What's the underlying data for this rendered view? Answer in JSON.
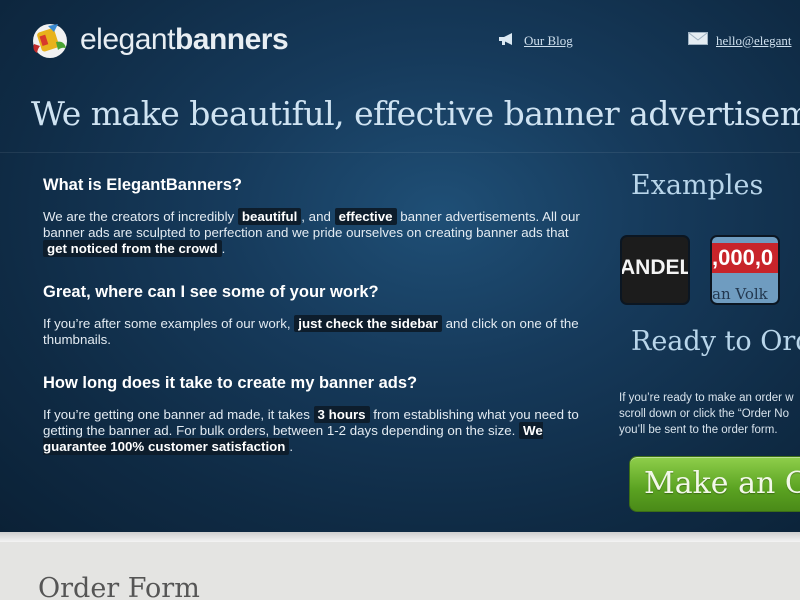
{
  "brand": {
    "name_light": "elegant",
    "name_bold": "banners"
  },
  "nav": {
    "blog_label": "Our Blog",
    "email_label": "hello@elegant"
  },
  "headline": "We make beautiful, effective banner advertisements f",
  "sections": [
    {
      "title": "What is ElegantBanners?",
      "body": [
        {
          "t": "We are the creators of incredibly "
        },
        {
          "t": "beautiful",
          "hl": true
        },
        {
          "t": ", and "
        },
        {
          "t": "effective",
          "hl": true
        },
        {
          "t": " banner advertisements. All our banner ads are sculpted to perfection and we pride ourselves on creating banner ads that "
        },
        {
          "t": "get noticed from the crowd",
          "hl": true
        },
        {
          "t": "."
        }
      ]
    },
    {
      "title": "Great, where can I see some of your work?",
      "body": [
        {
          "t": "If you’re after some examples of our work, "
        },
        {
          "t": "just check the sidebar",
          "hl": true
        },
        {
          "t": " and click on one of the thumbnails."
        }
      ]
    },
    {
      "title": "How long does it take to create my banner ads?",
      "body": [
        {
          "t": "If you’re getting one banner ad made, it takes "
        },
        {
          "t": "3 hours",
          "hl": true
        },
        {
          "t": " from establishing what you need to getting the banner ad. For bulk orders, between 1-2 days depending on the size. "
        },
        {
          "t": "We guarantee 100% customer satisfaction",
          "hl": true
        },
        {
          "t": "."
        }
      ]
    }
  ],
  "sidebar": {
    "examples_title": "Examples",
    "thumb1_text": "ANDEL",
    "thumb2_text_top": ",000,0",
    "thumb2_text_bottom": "an Volk",
    "ready_title": "Ready to Ord",
    "ready_lines": [
      "If you’re ready to make an order w",
      "scroll down or click the “Order No",
      "you’ll be sent to the order form."
    ],
    "order_button_label": "Make an Or"
  },
  "order_form_title": "Order Form",
  "colors": {
    "hero_bg": "#163a5b",
    "button_green": "#5aa221",
    "highlight_bg": "#0d1d2c"
  }
}
